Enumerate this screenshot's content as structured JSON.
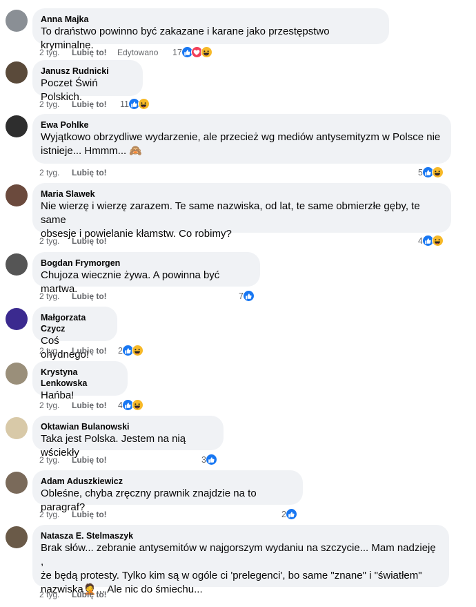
{
  "comments": [
    {
      "author": "Anna Majka",
      "text": "To draństwo powinno być zakazane i karane jako przestępstwo kryminalne.",
      "time": "2 tyg.",
      "like": "Lubię to!",
      "edited": "Edytowano",
      "reaction_count": "17",
      "reactions": [
        "like-icon",
        "love-icon",
        "haha-icon"
      ],
      "avatar_color": "#8a8f95"
    },
    {
      "author": "Janusz Rudnicki",
      "text": "Poczet Świń Polskich.",
      "time": "2 tyg.",
      "like": "Lubię to!",
      "reaction_count": "11",
      "reactions": [
        "like-icon",
        "haha-icon"
      ],
      "avatar_color": "#5a4a3a"
    },
    {
      "author": "Ewa Pohlke",
      "text": "Wyjątkowo obrzydliwe wydarzenie, ale przecież wg mediów antysemityzm w Polsce nie\nistnieje... Hmmm... 🙈",
      "time": "2 tyg.",
      "like": "Lubię to!",
      "reaction_count": "5",
      "reactions": [
        "like-icon",
        "haha-icon"
      ],
      "avatar_color": "#2e2e2e"
    },
    {
      "author": "Maria Slawek",
      "text": "Nie wierzę i wierzę zarazem. Te same nazwiska, od lat, te same obmierzłe gęby, te same\nobsesje i powielanie kłamstw. Co robimy?",
      "time": "2 tyg.",
      "like": "Lubię to!",
      "reaction_count": "4",
      "reactions": [
        "like-icon",
        "haha-icon"
      ],
      "avatar_color": "#6b4a3d"
    },
    {
      "author": "Bogdan Frymorgen",
      "text": "Chujoza wiecznie żywa. A powinna być martwa.",
      "time": "2 tyg.",
      "like": "Lubię to!",
      "reaction_count": "7",
      "reactions": [
        "like-icon"
      ],
      "avatar_color": "#555555"
    },
    {
      "author": "Małgorzata Czycz",
      "text": "Coś ohydnego!",
      "time": "2 tyg.",
      "like": "Lubię to!",
      "reaction_count": "2",
      "reactions": [
        "like-icon",
        "haha-icon"
      ],
      "avatar_color": "#3b2a8f"
    },
    {
      "author": "Krystyna Lenkowska",
      "text": "Hańba!",
      "time": "2 tyg.",
      "like": "Lubię to!",
      "reaction_count": "4",
      "reactions": [
        "like-icon",
        "haha-icon"
      ],
      "avatar_color": "#9a8f7a"
    },
    {
      "author": "Oktawian Bulanowski",
      "text": "Taka jest Polska. Jestem na nią wściekły",
      "time": "2 tyg.",
      "like": "Lubię to!",
      "reaction_count": "3",
      "reactions": [
        "like-icon"
      ],
      "avatar_color": "#d8c9a8"
    },
    {
      "author": "Adam Aduszkiewicz",
      "text": "Obleśne, chyba zręczny prawnik znajdzie na to paragraf?",
      "time": "2 tyg.",
      "like": "Lubię to!",
      "reaction_count": "2",
      "reactions": [
        "like-icon"
      ],
      "avatar_color": "#7a6a5a"
    },
    {
      "author": "Natasza E. Stelmaszyk",
      "text": "Brak słów... zebranie antysemitów w najgorszym wydaniu na szczycie... Mam nadzieję ,\nże będą protesty. Tylko kim są w ogóle ci 'prelegenci', bo same \"znane\" i \"światłem\"\nnazwiska🤦... Ale nic do śmiechu...",
      "time": "2 tyg.",
      "like": "Lubię to!",
      "reaction_count": "",
      "reactions": [],
      "avatar_color": "#6a5a48"
    }
  ]
}
